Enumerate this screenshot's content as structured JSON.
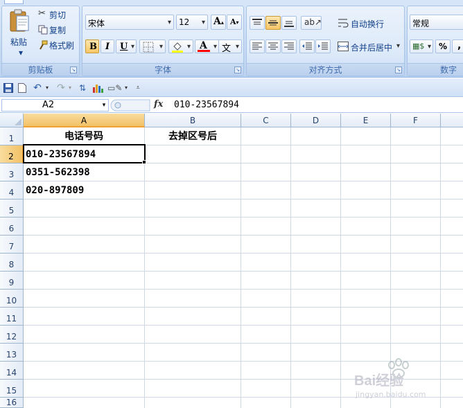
{
  "ribbon": {
    "clipboard": {
      "group_label": "剪贴板",
      "paste_label": "粘贴",
      "cut_label": "剪切",
      "copy_label": "复制",
      "format_painter_label": "格式刷"
    },
    "font": {
      "group_label": "字体",
      "font_name": "宋体",
      "font_size": "12",
      "bold": "B",
      "italic": "I",
      "underline": "U",
      "font_color_glyph": "A",
      "phonetic_glyph": "文"
    },
    "alignment": {
      "group_label": "对齐方式",
      "wrap_text_label": "自动换行",
      "merge_center_label": "合并后居中"
    },
    "number": {
      "group_label": "数字",
      "format_value": "常规",
      "percent_glyph": "%",
      "comma_glyph": ","
    }
  },
  "formula_bar": {
    "name_box": "A2",
    "fx_label": "fx",
    "value": "010-23567894"
  },
  "grid": {
    "columns": [
      "A",
      "B",
      "C",
      "D",
      "E",
      "F"
    ],
    "active_column": "A",
    "rows": [
      "1",
      "2",
      "3",
      "4",
      "5",
      "6",
      "7",
      "8",
      "9",
      "10",
      "11",
      "12",
      "13",
      "14",
      "15",
      "16"
    ],
    "active_row": "2",
    "cells": {
      "A1": "电话号码",
      "B1": "去掉区号后",
      "A2": "010-23567894",
      "A3": "0351-562398",
      "A4": "020-897809"
    }
  },
  "watermark": {
    "brand": "Bai经验",
    "url": "jingyan.baidu.com"
  },
  "colors": {
    "ribbon_bg": "#c7dbf3",
    "group_label": "#3e6aaa",
    "active_header": "#f2c166",
    "gridline": "#d0d7e5",
    "header_border": "#9eb6ce"
  }
}
